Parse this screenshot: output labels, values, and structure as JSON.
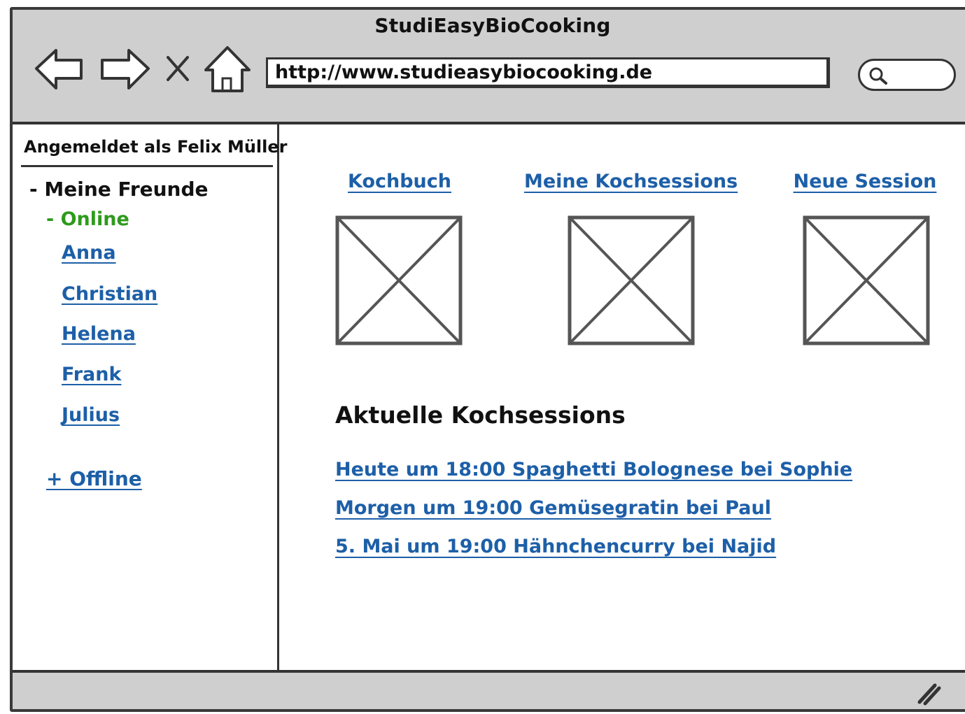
{
  "window": {
    "title": "StudiEasyBioCooking"
  },
  "toolbar": {
    "back_icon": "arrow-left-icon",
    "forward_icon": "arrow-right-icon",
    "stop_icon": "close-icon",
    "home_icon": "home-icon",
    "url": "http://www.studieasybiocooking.de",
    "search_icon": "search-icon"
  },
  "sidebar": {
    "user_label": "Angemeldet als Felix Müller",
    "friends_heading": "- Meine Freunde",
    "online_heading": "- Online",
    "online_friends": [
      "Anna",
      "Christian",
      "Helena",
      "Frank",
      "Julius"
    ],
    "offline_heading": "+ Offline"
  },
  "main": {
    "nav": [
      {
        "label": "Kochbuch"
      },
      {
        "label": "Meine Kochsessions"
      },
      {
        "label": "Neue Session"
      }
    ],
    "section_title": "Aktuelle Kochsessions",
    "sessions": [
      "Heute um 18:00 Spaghetti Bolognese bei Sophie",
      "Morgen um 19:00 Gemüsegratin bei Paul",
      "5. Mai um 19:00 Hähnchencurry bei Najid"
    ]
  },
  "colors": {
    "link": "#1d5fa8",
    "online": "#2e9a1c",
    "chrome": "#cfcfcf",
    "ink": "#333333"
  }
}
